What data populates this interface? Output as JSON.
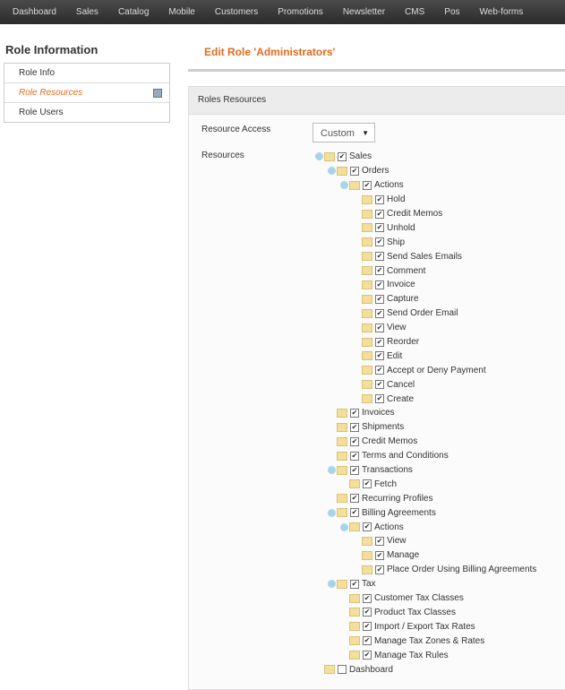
{
  "nav": [
    "Dashboard",
    "Sales",
    "Catalog",
    "Mobile",
    "Customers",
    "Promotions",
    "Newsletter",
    "CMS",
    "Pos",
    "Web-forms"
  ],
  "sidebar": {
    "title": "Role Information",
    "items": [
      "Role Info",
      "Role Resources",
      "Role Users"
    ]
  },
  "page_title": "Edit Role 'Administrators'",
  "panel": {
    "title": "Roles Resources",
    "resource_access_label": "Resource Access",
    "resource_access_value": "Custom",
    "resources_label": "Resources"
  },
  "tree": [
    {
      "label": "Sales",
      "level": 0,
      "expanded": true,
      "checked": true
    },
    {
      "label": "Orders",
      "level": 1,
      "expanded": true,
      "checked": true
    },
    {
      "label": "Actions",
      "level": 2,
      "expanded": true,
      "checked": true
    },
    {
      "label": "Hold",
      "level": 3,
      "checked": true
    },
    {
      "label": "Credit Memos",
      "level": 3,
      "checked": true
    },
    {
      "label": "Unhold",
      "level": 3,
      "checked": true
    },
    {
      "label": "Ship",
      "level": 3,
      "checked": true
    },
    {
      "label": "Send Sales Emails",
      "level": 3,
      "checked": true
    },
    {
      "label": "Comment",
      "level": 3,
      "checked": true
    },
    {
      "label": "Invoice",
      "level": 3,
      "checked": true
    },
    {
      "label": "Capture",
      "level": 3,
      "checked": true
    },
    {
      "label": "Send Order Email",
      "level": 3,
      "checked": true
    },
    {
      "label": "View",
      "level": 3,
      "checked": true
    },
    {
      "label": "Reorder",
      "level": 3,
      "checked": true
    },
    {
      "label": "Edit",
      "level": 3,
      "checked": true
    },
    {
      "label": "Accept or Deny Payment",
      "level": 3,
      "checked": true
    },
    {
      "label": "Cancel",
      "level": 3,
      "checked": true
    },
    {
      "label": "Create",
      "level": 3,
      "checked": true
    },
    {
      "label": "Invoices",
      "level": 1,
      "checked": true
    },
    {
      "label": "Shipments",
      "level": 1,
      "checked": true
    },
    {
      "label": "Credit Memos",
      "level": 1,
      "checked": true
    },
    {
      "label": "Terms and Conditions",
      "level": 1,
      "checked": true
    },
    {
      "label": "Transactions",
      "level": 1,
      "expanded": true,
      "checked": true
    },
    {
      "label": "Fetch",
      "level": 2,
      "checked": true
    },
    {
      "label": "Recurring Profiles",
      "level": 1,
      "checked": true
    },
    {
      "label": "Billing Agreements",
      "level": 1,
      "expanded": true,
      "checked": true
    },
    {
      "label": "Actions",
      "level": 2,
      "expanded": true,
      "checked": true
    },
    {
      "label": "View",
      "level": 3,
      "checked": true
    },
    {
      "label": "Manage",
      "level": 3,
      "checked": true
    },
    {
      "label": "Place Order Using Billing Agreements",
      "level": 3,
      "checked": true
    },
    {
      "label": "Tax",
      "level": 1,
      "expanded": true,
      "checked": true
    },
    {
      "label": "Customer Tax Classes",
      "level": 2,
      "checked": true
    },
    {
      "label": "Product Tax Classes",
      "level": 2,
      "checked": true
    },
    {
      "label": "Import / Export Tax Rates",
      "level": 2,
      "checked": true
    },
    {
      "label": "Manage Tax Zones & Rates",
      "level": 2,
      "checked": true
    },
    {
      "label": "Manage Tax Rules",
      "level": 2,
      "checked": true
    },
    {
      "label": "Dashboard",
      "level": 0,
      "checked": false
    }
  ]
}
